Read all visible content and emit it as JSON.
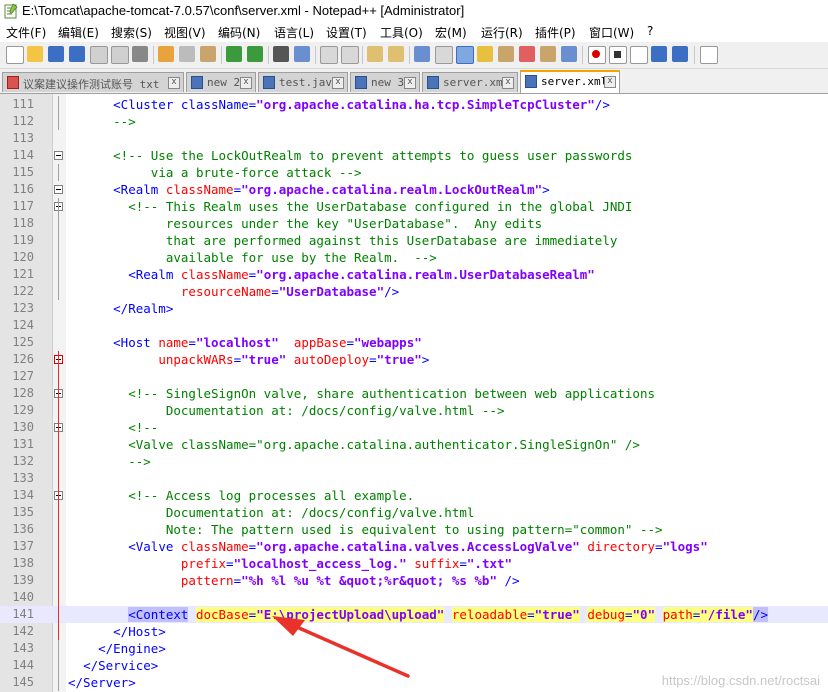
{
  "window": {
    "title": "E:\\Tomcat\\apache-tomcat-7.0.57\\conf\\server.xml - Notepad++ [Administrator]"
  },
  "menu": [
    "文件(F)",
    "编辑(E)",
    "搜索(S)",
    "视图(V)",
    "编码(N)",
    "语言(L)",
    "设置(T)",
    "工具(O)",
    "宏(M)",
    "运行(R)",
    "插件(P)",
    "窗口(W)",
    "?"
  ],
  "tabs": [
    {
      "label": "议案建议操作测试账号 txt",
      "active": false
    },
    {
      "label": "new 2",
      "active": false
    },
    {
      "label": "test.java",
      "active": false
    },
    {
      "label": "new 3",
      "active": false
    },
    {
      "label": "server.xml",
      "active": false
    },
    {
      "label": "server.xml",
      "active": true
    }
  ],
  "tab_close": "x",
  "editor": {
    "current_line": "141",
    "lines": [
      {
        "num": "111",
        "segs": [
          [
            "      ",
            ""
          ],
          [
            "<Cluster ",
            "tag"
          ],
          [
            "className",
            "tag"
          ],
          [
            "=",
            "tag"
          ],
          [
            "\"org.apache.catalina.ha.tcp.SimpleTcpCluster\"",
            "val"
          ],
          [
            "/>",
            "tag"
          ]
        ]
      },
      {
        "num": "112",
        "segs": [
          [
            "      ",
            ""
          ],
          [
            "-->",
            "cmt"
          ]
        ]
      },
      {
        "num": "113",
        "segs": []
      },
      {
        "num": "114",
        "segs": [
          [
            "      ",
            ""
          ],
          [
            "<!-- Use the LockOutRealm to prevent attempts to guess user passwords",
            "cmt"
          ]
        ]
      },
      {
        "num": "115",
        "segs": [
          [
            "           ",
            ""
          ],
          [
            "via a brute-force attack -->",
            "cmt"
          ]
        ]
      },
      {
        "num": "116",
        "segs": [
          [
            "      ",
            ""
          ],
          [
            "<Realm ",
            "tag"
          ],
          [
            "className",
            "attr"
          ],
          [
            "=",
            "tag"
          ],
          [
            "\"org.apache.catalina.realm.LockOutRealm\"",
            "val"
          ],
          [
            ">",
            "tag"
          ]
        ]
      },
      {
        "num": "117",
        "segs": [
          [
            "        ",
            ""
          ],
          [
            "<!-- This Realm uses the UserDatabase configured in the global JNDI",
            "cmt"
          ]
        ]
      },
      {
        "num": "118",
        "segs": [
          [
            "             ",
            ""
          ],
          [
            "resources under the key \"UserDatabase\".  Any edits",
            "cmt"
          ]
        ]
      },
      {
        "num": "119",
        "segs": [
          [
            "             ",
            ""
          ],
          [
            "that are performed against this UserDatabase are immediately",
            "cmt"
          ]
        ]
      },
      {
        "num": "120",
        "segs": [
          [
            "             ",
            ""
          ],
          [
            "available for use by the Realm.  -->",
            "cmt"
          ]
        ]
      },
      {
        "num": "121",
        "segs": [
          [
            "        ",
            ""
          ],
          [
            "<Realm ",
            "tag"
          ],
          [
            "className",
            "attr"
          ],
          [
            "=",
            "tag"
          ],
          [
            "\"org.apache.catalina.realm.UserDatabaseRealm\"",
            "val"
          ]
        ]
      },
      {
        "num": "122",
        "segs": [
          [
            "               ",
            ""
          ],
          [
            "resourceName",
            "attr"
          ],
          [
            "=",
            "tag"
          ],
          [
            "\"UserDatabase\"",
            "val"
          ],
          [
            "/>",
            "tag"
          ]
        ]
      },
      {
        "num": "123",
        "segs": [
          [
            "      ",
            ""
          ],
          [
            "</Realm>",
            "tag"
          ]
        ]
      },
      {
        "num": "124",
        "segs": []
      },
      {
        "num": "125",
        "segs": [
          [
            "      ",
            ""
          ],
          [
            "<Host ",
            "tag"
          ],
          [
            "name",
            "attr"
          ],
          [
            "=",
            "tag"
          ],
          [
            "\"localhost\"",
            "val"
          ],
          [
            "  ",
            ""
          ],
          [
            "appBase",
            "attr"
          ],
          [
            "=",
            "tag"
          ],
          [
            "\"webapps\"",
            "val"
          ]
        ]
      },
      {
        "num": "126",
        "segs": [
          [
            "            ",
            ""
          ],
          [
            "unpackWARs",
            "attr"
          ],
          [
            "=",
            "tag"
          ],
          [
            "\"true\"",
            "val"
          ],
          [
            " ",
            ""
          ],
          [
            "autoDeploy",
            "attr"
          ],
          [
            "=",
            "tag"
          ],
          [
            "\"true\"",
            "val"
          ],
          [
            ">",
            "tag"
          ]
        ]
      },
      {
        "num": "127",
        "segs": []
      },
      {
        "num": "128",
        "segs": [
          [
            "        ",
            ""
          ],
          [
            "<!-- SingleSignOn valve, share authentication between web applications",
            "cmt"
          ]
        ]
      },
      {
        "num": "129",
        "segs": [
          [
            "             ",
            ""
          ],
          [
            "Documentation at: /docs/config/valve.html -->",
            "cmt"
          ]
        ]
      },
      {
        "num": "130",
        "segs": [
          [
            "        ",
            ""
          ],
          [
            "<!--",
            "cmt"
          ]
        ]
      },
      {
        "num": "131",
        "segs": [
          [
            "        ",
            ""
          ],
          [
            "<Valve className=\"org.apache.catalina.authenticator.SingleSignOn\" />",
            "cmt"
          ]
        ]
      },
      {
        "num": "132",
        "segs": [
          [
            "        ",
            ""
          ],
          [
            "-->",
            "cmt"
          ]
        ]
      },
      {
        "num": "133",
        "segs": []
      },
      {
        "num": "134",
        "segs": [
          [
            "        ",
            ""
          ],
          [
            "<!-- Access log processes all example.",
            "cmt"
          ]
        ]
      },
      {
        "num": "135",
        "segs": [
          [
            "             ",
            ""
          ],
          [
            "Documentation at: /docs/config/valve.html",
            "cmt"
          ]
        ]
      },
      {
        "num": "136",
        "segs": [
          [
            "             ",
            ""
          ],
          [
            "Note: The pattern used is equivalent to using pattern=\"common\" -->",
            "cmt"
          ]
        ]
      },
      {
        "num": "137",
        "segs": [
          [
            "        ",
            ""
          ],
          [
            "<Valve ",
            "tag"
          ],
          [
            "className",
            "attr"
          ],
          [
            "=",
            "tag"
          ],
          [
            "\"org.apache.catalina.valves.AccessLogValve\"",
            "val"
          ],
          [
            " ",
            ""
          ],
          [
            "directory",
            "attr"
          ],
          [
            "=",
            "tag"
          ],
          [
            "\"logs\"",
            "val"
          ]
        ]
      },
      {
        "num": "138",
        "segs": [
          [
            "               ",
            ""
          ],
          [
            "prefix",
            "attr"
          ],
          [
            "=",
            "tag"
          ],
          [
            "\"localhost_access_log.\"",
            "val"
          ],
          [
            " ",
            ""
          ],
          [
            "suffix",
            "attr"
          ],
          [
            "=",
            "tag"
          ],
          [
            "\".txt\"",
            "val"
          ]
        ]
      },
      {
        "num": "139",
        "segs": [
          [
            "               ",
            ""
          ],
          [
            "pattern",
            "attr"
          ],
          [
            "=",
            "tag"
          ],
          [
            "\"%h %l %u %t &quot;%r&quot; %s %b\"",
            "val"
          ],
          [
            " />",
            "tag"
          ]
        ]
      },
      {
        "num": "140",
        "segs": []
      },
      {
        "num": "141",
        "segs": [
          [
            "        ",
            ""
          ],
          [
            "<Context",
            "tag hlb"
          ],
          [
            " ",
            ""
          ],
          [
            "docBase",
            "attr hl"
          ],
          [
            "=",
            "tag hl"
          ],
          [
            "\"E:\\projectUpload\\upload\"",
            "val hl"
          ],
          [
            " ",
            ""
          ],
          [
            "reloadable",
            "attr hl"
          ],
          [
            "=",
            "tag hl"
          ],
          [
            "\"true\"",
            "val hl"
          ],
          [
            " ",
            ""
          ],
          [
            "debug",
            "attr hl"
          ],
          [
            "=",
            "tag hl"
          ],
          [
            "\"0\"",
            "val hl"
          ],
          [
            " ",
            ""
          ],
          [
            "path",
            "attr hl"
          ],
          [
            "=",
            "tag hl"
          ],
          [
            "\"/file\"",
            "val hl"
          ],
          [
            "/>",
            "tag hlb"
          ]
        ]
      },
      {
        "num": "142",
        "segs": [
          [
            "      ",
            ""
          ],
          [
            "</Host>",
            "tag"
          ]
        ]
      },
      {
        "num": "143",
        "segs": [
          [
            "    ",
            ""
          ],
          [
            "</Engine>",
            "tag"
          ]
        ]
      },
      {
        "num": "144",
        "segs": [
          [
            "  ",
            ""
          ],
          [
            "</Service>",
            "tag"
          ]
        ]
      },
      {
        "num": "145",
        "segs": [
          [
            "",
            ""
          ],
          [
            "</Server>",
            "tag"
          ]
        ]
      }
    ]
  },
  "watermark": "https://blog.csdn.net/roctsai"
}
